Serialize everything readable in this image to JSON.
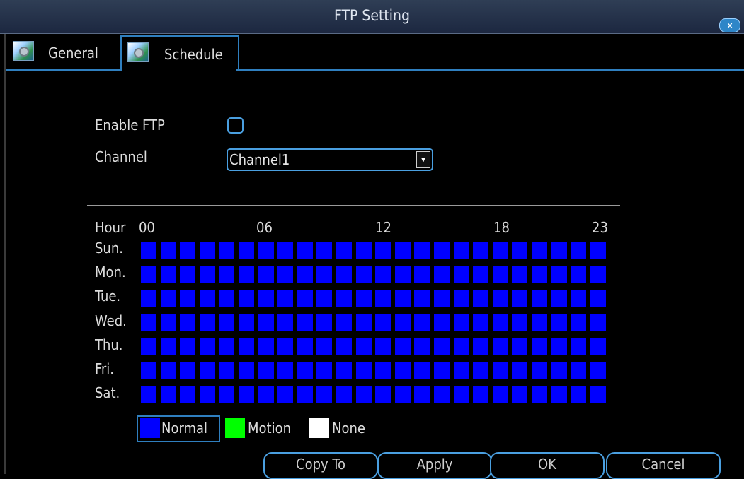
{
  "window": {
    "title": "FTP Setting",
    "close_glyph": "×",
    "close_icon": "close-icon"
  },
  "tabs": [
    {
      "label": "General",
      "icon": "gear-icon",
      "active": false
    },
    {
      "label": "Schedule",
      "icon": "gear-icon",
      "active": true
    }
  ],
  "form": {
    "enable_ftp_label": "Enable FTP",
    "enable_ftp_checked": false,
    "channel_label": "Channel",
    "channel_value": "Channel1",
    "dropdown_glyph": "▾"
  },
  "schedule": {
    "hour_label": "Hour",
    "hour_ticks": [
      "00",
      "06",
      "12",
      "18",
      "23"
    ],
    "days": [
      "Sun.",
      "Mon.",
      "Tue.",
      "Wed.",
      "Thu.",
      "Fri.",
      "Sat."
    ],
    "hours_per_day": 24,
    "fill_mode": "Normal"
  },
  "legend": [
    {
      "label": "Normal",
      "color": "#0000ff",
      "selected": true
    },
    {
      "label": "Motion",
      "color": "#00ff00",
      "selected": false
    },
    {
      "label": "None",
      "color": "#ffffff",
      "selected": false
    }
  ],
  "buttons": {
    "copy_to": "Copy To",
    "apply": "Apply",
    "ok": "OK",
    "cancel": "Cancel"
  }
}
